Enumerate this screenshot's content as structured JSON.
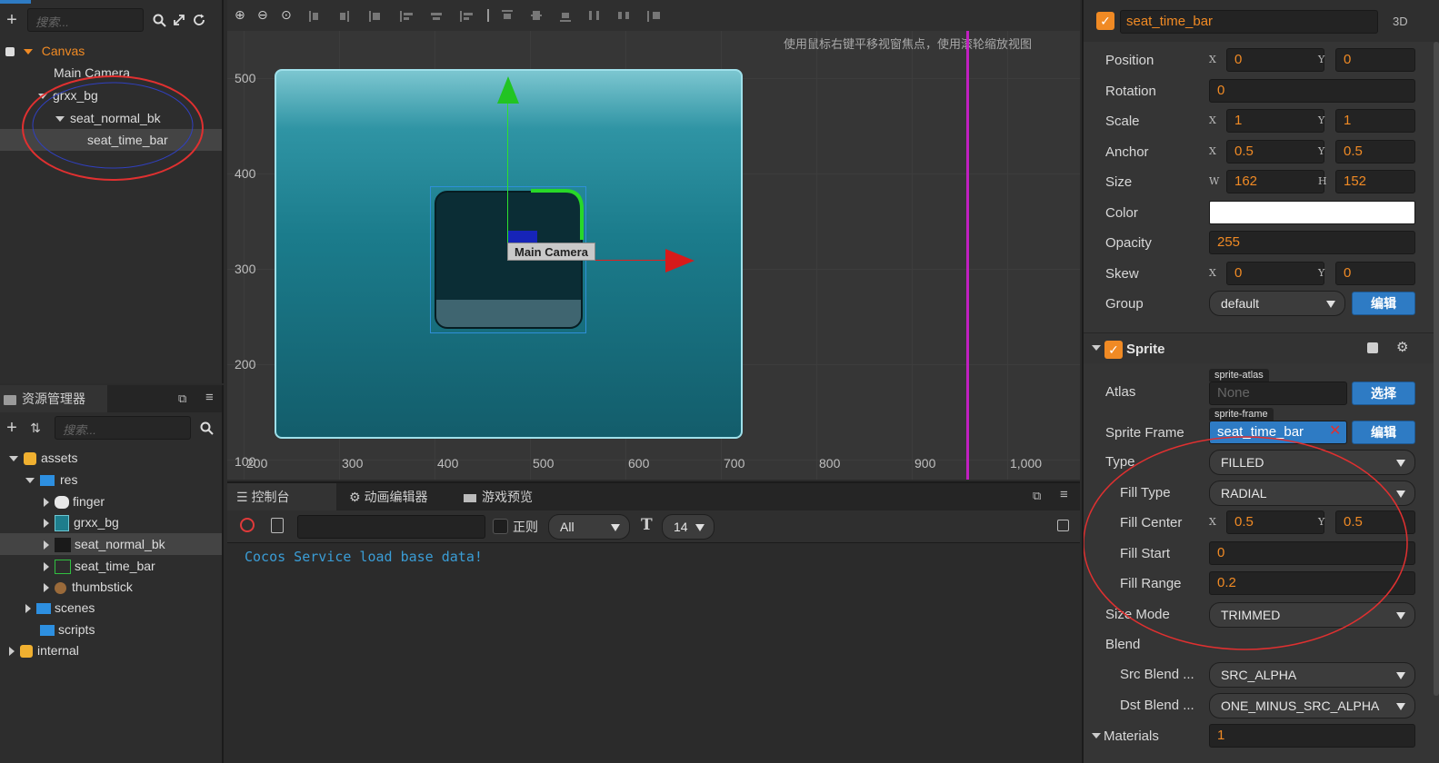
{
  "hierarchy": {
    "search_placeholder": "搜索...",
    "nodes": [
      {
        "label": "Canvas"
      },
      {
        "label": "Main Camera"
      },
      {
        "label": "grxx_bg"
      },
      {
        "label": "seat_normal_bk"
      },
      {
        "label": "seat_time_bar"
      }
    ]
  },
  "assets": {
    "tab_label": "资源管理器",
    "search_placeholder": "搜索...",
    "items": [
      {
        "label": "assets"
      },
      {
        "label": "res"
      },
      {
        "label": "finger"
      },
      {
        "label": "grxx_bg"
      },
      {
        "label": "seat_normal_bk"
      },
      {
        "label": "seat_time_bar"
      },
      {
        "label": "thumbstick"
      },
      {
        "label": "scenes"
      },
      {
        "label": "scripts"
      },
      {
        "label": "internal"
      }
    ]
  },
  "scene": {
    "hint": "使用鼠标右键平移视窗焦点，使用滚轮缩放视图",
    "camera_label": "Main Camera",
    "y_ticks": [
      "500",
      "400",
      "300",
      "200",
      "100"
    ],
    "x_ticks": [
      "200",
      "300",
      "400",
      "500",
      "600",
      "700",
      "800",
      "900",
      "1,000"
    ]
  },
  "console": {
    "tabs": [
      "控制台",
      "动画编辑器",
      "游戏预览"
    ],
    "regex_label": "正则",
    "level_select": "All",
    "font_size": "14",
    "log_line": "Cocos Service load base data!"
  },
  "inspector": {
    "node_name": "seat_time_bar",
    "mode_3d": "3D",
    "position": {
      "label": "Position",
      "x": "0",
      "y": "0"
    },
    "rotation": {
      "label": "Rotation",
      "value": "0"
    },
    "scale": {
      "label": "Scale",
      "x": "1",
      "y": "1"
    },
    "anchor": {
      "label": "Anchor",
      "x": "0.5",
      "y": "0.5"
    },
    "size": {
      "label": "Size",
      "w": "162",
      "h": "152"
    },
    "color": {
      "label": "Color",
      "value": "#ffffff"
    },
    "opacity": {
      "label": "Opacity",
      "value": "255"
    },
    "skew": {
      "label": "Skew",
      "x": "0",
      "y": "0"
    },
    "group": {
      "label": "Group",
      "value": "default",
      "button": "编辑"
    },
    "sprite": {
      "title": "Sprite",
      "atlas": {
        "label": "Atlas",
        "tag": "sprite-atlas",
        "value": "None",
        "button": "选择"
      },
      "sprite_frame": {
        "label": "Sprite Frame",
        "tag": "sprite-frame",
        "value": "seat_time_bar",
        "button": "编辑"
      },
      "type": {
        "label": "Type",
        "value": "FILLED"
      },
      "fill_type": {
        "label": "Fill Type",
        "value": "RADIAL"
      },
      "fill_center": {
        "label": "Fill Center",
        "x": "0.5",
        "y": "0.5"
      },
      "fill_start": {
        "label": "Fill Start",
        "value": "0"
      },
      "fill_range": {
        "label": "Fill Range",
        "value": "0.2"
      },
      "size_mode": {
        "label": "Size Mode",
        "value": "TRIMMED"
      },
      "blend": {
        "label": "Blend"
      },
      "src_blend": {
        "label": "Src Blend ...",
        "value": "SRC_ALPHA"
      },
      "dst_blend": {
        "label": "Dst Blend ...",
        "value": "ONE_MINUS_SRC_ALPHA"
      },
      "materials": {
        "label": "Materials",
        "value": "1"
      }
    },
    "axis_letters": {
      "x": "X",
      "y": "Y",
      "w": "W",
      "h": "H"
    }
  },
  "colors": {
    "accent_orange": "#f08a24",
    "button_blue": "#2e7bc4",
    "annotation_red": "#e03030",
    "guide_magenta": "#c020c0",
    "console_text": "#3a9dd6"
  }
}
